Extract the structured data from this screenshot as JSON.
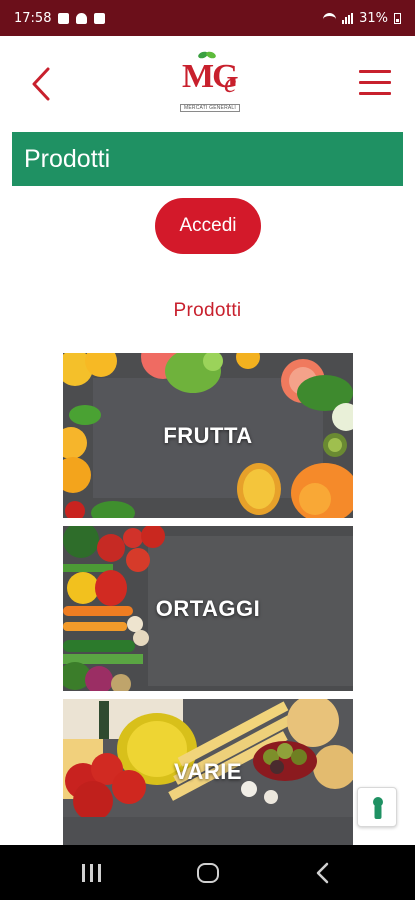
{
  "status_bar": {
    "time": "17:58",
    "battery": "31%",
    "icons": [
      "image-icon",
      "alert-icon",
      "app-icon",
      "wifi-icon",
      "signal-icon",
      "battery-icon"
    ]
  },
  "header": {
    "back_icon": "chevron-left-icon",
    "menu_icon": "hamburger-menu-icon",
    "logo": {
      "text_main": "MG",
      "text_e": "e",
      "subtitle": "MERCATI GENERALI",
      "colors": {
        "brand_red": "#c8202d",
        "leaf_green": "#3aa041"
      }
    }
  },
  "page_title": "Prodotti",
  "login_button": "Accedi",
  "section_title": "Prodotti",
  "categories": [
    {
      "label": "FRUTTA"
    },
    {
      "label": "ORTAGGI"
    },
    {
      "label": "VARIE"
    }
  ],
  "floating_button_icon": "lock-icon",
  "nav_bar": {
    "recents_icon": "recents-icon",
    "home_icon": "home-icon",
    "back_icon": "back-icon"
  },
  "colors": {
    "status_bar": "#6b0f1a",
    "title_bar": "#1f9163",
    "accent_red": "#d3192a"
  }
}
